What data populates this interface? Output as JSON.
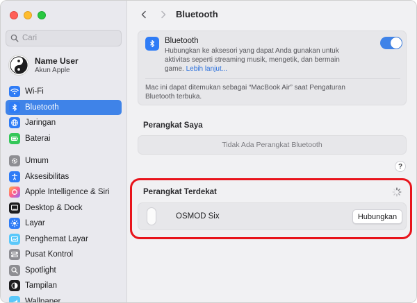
{
  "window": {
    "controls": [
      "close",
      "minimize",
      "zoom"
    ]
  },
  "search": {
    "placeholder": "Cari",
    "icon": "search-icon"
  },
  "account": {
    "name": "Name User",
    "subtitle": "Akun Apple",
    "icon": "yin-yang-avatar"
  },
  "sidebar": {
    "group1": [
      {
        "label": "Wi-Fi",
        "icon": "wifi-icon",
        "color": "#2f7cf6",
        "active": false
      },
      {
        "label": "Bluetooth",
        "icon": "bluetooth-icon",
        "color": "#2f7cf6",
        "active": true
      },
      {
        "label": "Jaringan",
        "icon": "globe-icon",
        "color": "#2f7cf6",
        "active": false
      },
      {
        "label": "Baterai",
        "icon": "battery-icon",
        "color": "#34c759",
        "active": false
      }
    ],
    "group2": [
      {
        "label": "Umum",
        "icon": "gear-icon",
        "color": "#8e8e93",
        "active": false
      },
      {
        "label": "Aksesibilitas",
        "icon": "accessibility-icon",
        "color": "#2f7cf6",
        "active": false
      },
      {
        "label": "Apple Intelligence & Siri",
        "icon": "siri-icon",
        "color": "#ff7a45",
        "active": false
      },
      {
        "label": "Desktop & Dock",
        "icon": "dock-icon",
        "color": "#1d1d1f",
        "active": false
      },
      {
        "label": "Layar",
        "icon": "sun-icon",
        "color": "#2f7cf6",
        "active": false
      },
      {
        "label": "Penghemat Layar",
        "icon": "screensaver-icon",
        "color": "#5ac8fa",
        "active": false
      },
      {
        "label": "Pusat Kontrol",
        "icon": "control-center-icon",
        "color": "#8e8e93",
        "active": false
      },
      {
        "label": "Spotlight",
        "icon": "spotlight-search-icon",
        "color": "#8e8e93",
        "active": false
      },
      {
        "label": "Tampilan",
        "icon": "appearance-icon",
        "color": "#1d1d1f",
        "active": false
      },
      {
        "label": "Wallpaper",
        "icon": "wallpaper-icon",
        "color": "#5ac8fa",
        "active": false
      }
    ]
  },
  "toolbar": {
    "title": "Bluetooth",
    "back_icon": "chevron-left-icon",
    "forward_icon": "chevron-right-icon"
  },
  "bluetooth": {
    "title": "Bluetooth",
    "description": "Hubungkan ke aksesori yang dapat Anda gunakan untuk aktivitas seperti streaming musik, mengetik, dan bermain game.",
    "learn_more": "Lebih lanjut...",
    "enabled": true,
    "note": "Mac ini dapat ditemukan sebagai “MacBook Air” saat Pengaturan Bluetooth terbuka."
  },
  "my_devices": {
    "heading": "Perangkat Saya",
    "empty": "Tidak Ada Perangkat Bluetooth"
  },
  "help": {
    "label": "?"
  },
  "nearby": {
    "heading": "Perangkat Terdekat",
    "devices": [
      {
        "name": "OSMOD Six",
        "action": "Hubungkan",
        "icon": "mouse-icon"
      }
    ]
  },
  "colors": {
    "accent": "#3f83e8",
    "highlight": "#e8141b",
    "sidebar_bg": "#e9e9ee",
    "main_bg": "#f1f1f3"
  }
}
